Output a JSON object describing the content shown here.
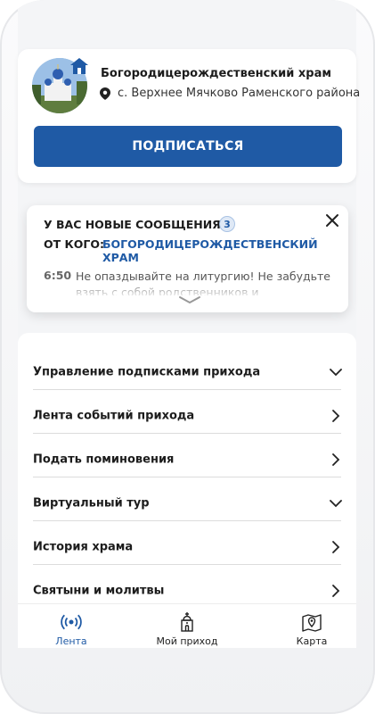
{
  "parish": {
    "title": "Богородицерождественский храм",
    "location": "с. Верхнее Мячково Раменского района",
    "subscribe_label": "ПОДПИСАТЬСЯ"
  },
  "notification": {
    "title": "У ВАС НОВЫЕ СООБЩЕНИЯ",
    "count": "3",
    "from_label": "ОТ КОГО:",
    "from_name": "БОГОРОДИЦЕРОЖДЕСТВЕНСКИЙ ХРАМ",
    "time": "6:50",
    "text": "Не опаздывайте на литургию! Не забудьте взять с собой родственников и"
  },
  "menu": {
    "items": [
      {
        "label": "Управление подписками прихода",
        "chevron": "down"
      },
      {
        "label": "Лента событий прихода",
        "chevron": "right"
      },
      {
        "label": "Подать поминовения",
        "chevron": "right"
      },
      {
        "label": "Виртуальный тур",
        "chevron": "down"
      },
      {
        "label": "История храма",
        "chevron": "right"
      },
      {
        "label": "Святыни и молитвы",
        "chevron": "right"
      }
    ]
  },
  "tabs": [
    {
      "label": "Лента",
      "icon": "broadcast-icon",
      "active": true
    },
    {
      "label": "Мой приход",
      "icon": "church-icon",
      "active": false
    },
    {
      "label": "Карта",
      "icon": "map-icon",
      "active": false
    }
  ],
  "colors": {
    "accent": "#1f5aa5",
    "text": "#1c1c1c"
  }
}
